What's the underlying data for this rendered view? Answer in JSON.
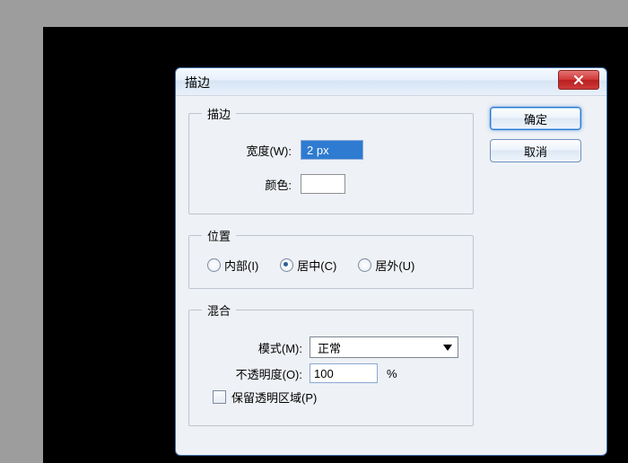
{
  "dialog": {
    "title": "描边",
    "close_icon": "x"
  },
  "stroke": {
    "legend": "描边",
    "width_label": "宽度(W):",
    "width_value": "2 px",
    "color_label": "颜色:",
    "color_hex": "#ffffff"
  },
  "position": {
    "legend": "位置",
    "options": [
      {
        "label": "内部(I)",
        "selected": false
      },
      {
        "label": "居中(C)",
        "selected": true
      },
      {
        "label": "居外(U)",
        "selected": false
      }
    ]
  },
  "blend": {
    "legend": "混合",
    "mode_label": "模式(M):",
    "mode_value": "正常",
    "opacity_label": "不透明度(O):",
    "opacity_value": "100",
    "opacity_suffix": "%",
    "preserve_label": "保留透明区域(P)",
    "preserve_checked": false
  },
  "buttons": {
    "ok": "确定",
    "cancel": "取消"
  }
}
